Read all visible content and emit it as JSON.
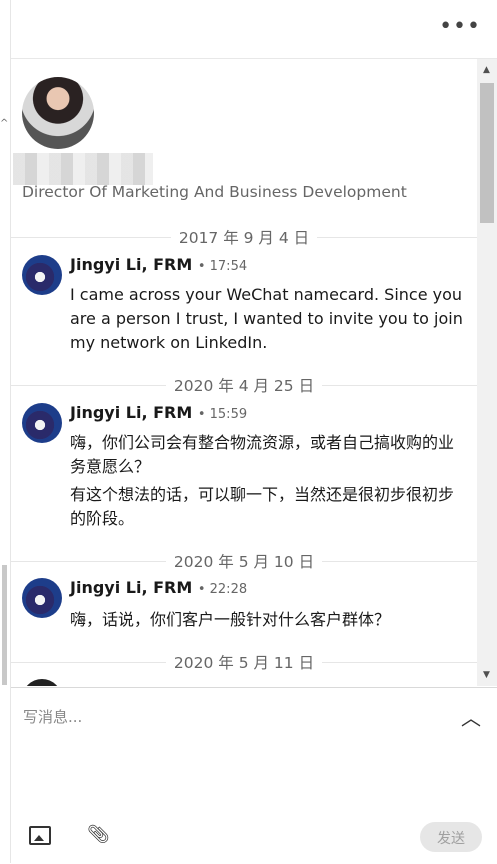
{
  "profile": {
    "headline": "Director Of Marketing And Business Development"
  },
  "conversation": [
    {
      "date": "2017 年 9 月 4 日",
      "sender": "Jingyi Li, FRM",
      "time": "• 17:54",
      "lines": [
        "I came across your WeChat namecard. Since you",
        "are a person I trust, I wanted to invite you to join",
        "my network on LinkedIn."
      ]
    },
    {
      "date": "2020 年 4 月 25 日",
      "sender": "Jingyi Li, FRM",
      "time": "• 15:59",
      "lines": [
        "嗨，你们公司会有整合物流资源，或者自己搞收购的业",
        "务意愿么？",
        "有这个想法的话，可以聊一下，当然还是很初步很初步",
        "的阶段。"
      ]
    },
    {
      "date": "2020 年 5 月 10 日",
      "sender": "Jingyi Li, FRM",
      "time": "• 22:28",
      "lines": [
        "嗨，话说，你们客户一般针对什么客户群体？"
      ]
    },
    {
      "date": "2020 年 5 月 11 日"
    }
  ],
  "compose": {
    "placeholder": "写消息...",
    "send_label": "发送"
  },
  "icons": {
    "more": "more-horizontal-icon",
    "collapse": "chevron-up-icon",
    "image": "image-icon",
    "attach": "paperclip-icon"
  }
}
